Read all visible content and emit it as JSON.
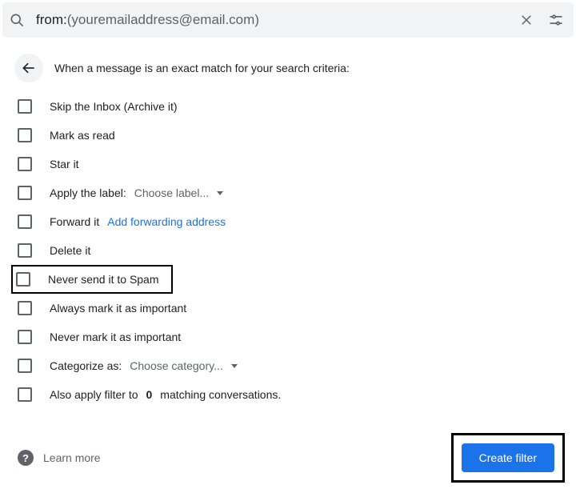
{
  "search": {
    "prefix": "from:",
    "open_paren": "(",
    "email": "youremailaddress@email.com",
    "close_paren": ")"
  },
  "header": {
    "text": "When a message is an exact match for your search criteria:"
  },
  "options": {
    "skip_inbox": "Skip the Inbox (Archive it)",
    "mark_read": "Mark as read",
    "star_it": "Star it",
    "apply_label": "Apply the label:",
    "apply_label_dropdown": "Choose label...",
    "forward_it": "Forward it",
    "forward_link": "Add forwarding address",
    "delete_it": "Delete it",
    "never_spam": "Never send it to Spam",
    "always_important": "Always mark it as important",
    "never_important": "Never mark it as important",
    "categorize_as": "Categorize as:",
    "categorize_dropdown": "Choose category...",
    "also_apply_pre": "Also apply filter to ",
    "also_apply_count": "0",
    "also_apply_post": " matching conversations."
  },
  "footer": {
    "learn_more": "Learn more",
    "create_filter": "Create filter"
  }
}
